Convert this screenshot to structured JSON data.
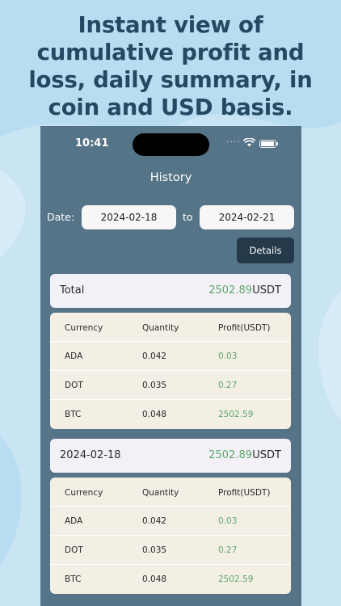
{
  "headline": {
    "line1": "Instant view of",
    "line2": "cumulative profit and",
    "line3": "loss, daily summary, in",
    "line4": "coin and USD basis."
  },
  "status_bar": {
    "time": "10:41",
    "signal": "...."
  },
  "nav": {
    "title": "History"
  },
  "date_filter": {
    "label": "Date:",
    "from": "2024-02-18",
    "to_label": "to",
    "to": "2024-02-21"
  },
  "details_button": {
    "label": "Details"
  },
  "colors": {
    "profit_green": "#5da76b",
    "screen_bg": "#567488",
    "button_dark": "#24394a",
    "headline": "#244a63"
  },
  "sections": [
    {
      "label": "Total",
      "value": "2502.89",
      "unit": "USDT",
      "columns": [
        "Currency",
        "Quantity",
        "Profit(USDT)"
      ],
      "rows": [
        {
          "currency": "ADA",
          "quantity": "0.042",
          "profit": "0.03"
        },
        {
          "currency": "DOT",
          "quantity": "0.035",
          "profit": "0.27"
        },
        {
          "currency": "BTC",
          "quantity": "0.048",
          "profit": "2502.59"
        }
      ]
    },
    {
      "label": "2024-02-18",
      "value": "2502.89",
      "unit": "USDT",
      "columns": [
        "Currency",
        "Quantity",
        "Profit(USDT)"
      ],
      "rows": [
        {
          "currency": "ADA",
          "quantity": "0.042",
          "profit": "0.03"
        },
        {
          "currency": "DOT",
          "quantity": "0.035",
          "profit": "0.27"
        },
        {
          "currency": "BTC",
          "quantity": "0.048",
          "profit": "2502.59"
        }
      ]
    }
  ]
}
